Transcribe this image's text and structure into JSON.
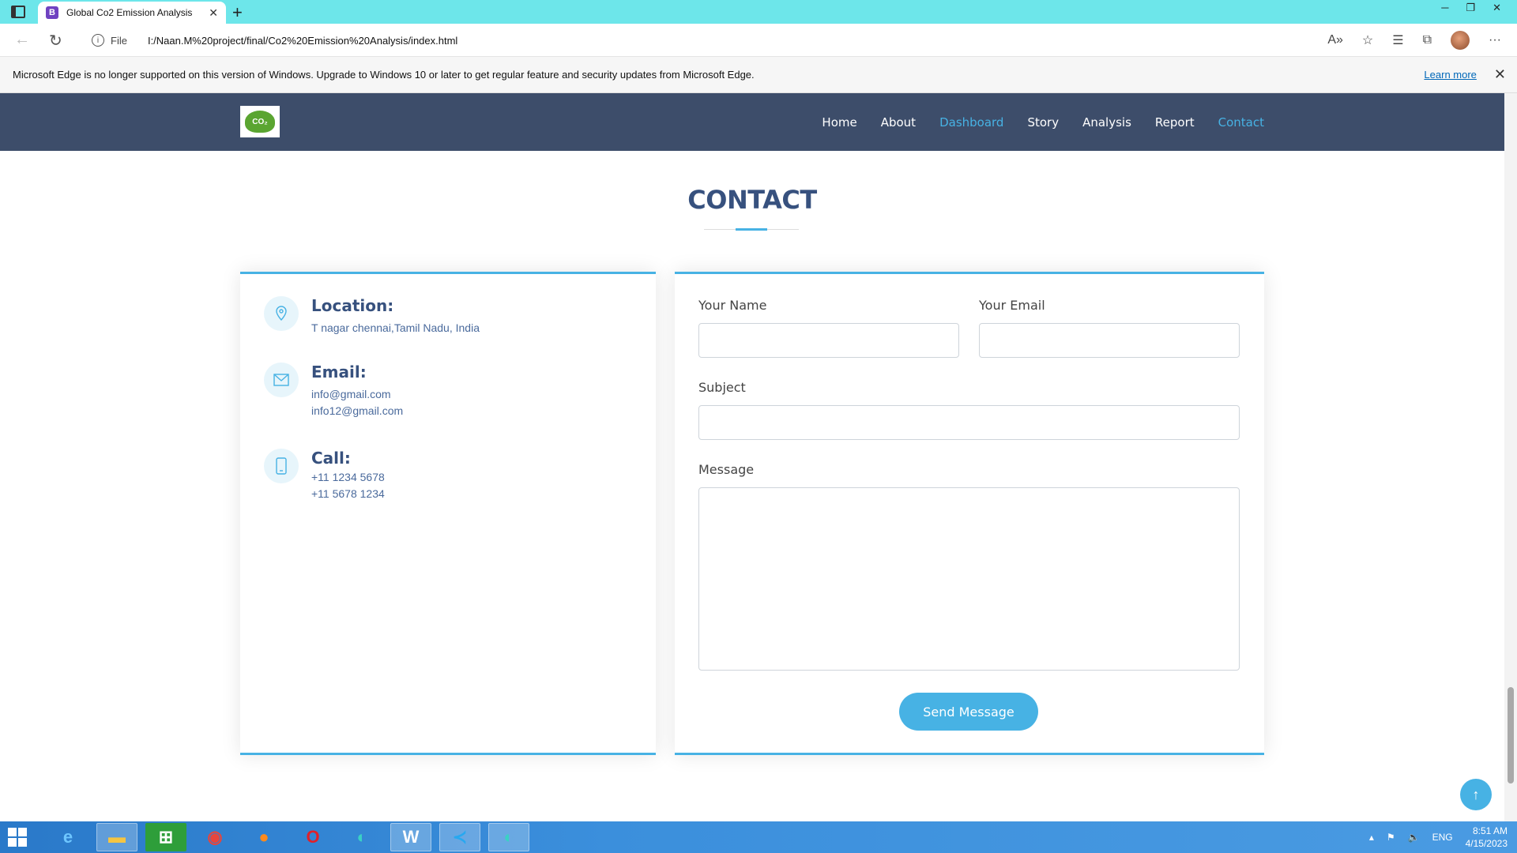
{
  "browser": {
    "tab_title": "Global Co2 Emission Analysis",
    "tab_favicon": "B",
    "url_prefix": "File",
    "url": "I:/Naan.M%20project/final/Co2%20Emission%20Analysis/index.html",
    "infobar_text": "Microsoft Edge is no longer supported on this version of Windows. Upgrade to Windows 10 or later to get regular feature and security updates from Microsoft Edge.",
    "infobar_link": "Learn more"
  },
  "site": {
    "logo_text": "CO₂",
    "nav": [
      {
        "label": "Home"
      },
      {
        "label": "About"
      },
      {
        "label": "Dashboard"
      },
      {
        "label": "Story"
      },
      {
        "label": "Analysis"
      },
      {
        "label": "Report"
      },
      {
        "label": "Contact"
      }
    ],
    "section_title": "CONTACT"
  },
  "contact_info": {
    "location": {
      "heading": "Location:",
      "line1": "T nagar chennai,Tamil Nadu, India"
    },
    "email": {
      "heading": "Email:",
      "line1": "info@gmail.com",
      "line2": "info12@gmail.com"
    },
    "call": {
      "heading": "Call:",
      "line1": "+11 1234 5678",
      "line2": "+11 5678 1234"
    }
  },
  "form": {
    "name_label": "Your Name",
    "email_label": "Your Email",
    "subject_label": "Subject",
    "message_label": "Message",
    "send_label": "Send Message"
  },
  "taskbar": {
    "language": "ENG",
    "time": "8:51 AM",
    "date": "4/15/2023"
  },
  "colors": {
    "header_bg": "#3d4d6a",
    "accent": "#47b2e4",
    "title": "#37517e"
  }
}
